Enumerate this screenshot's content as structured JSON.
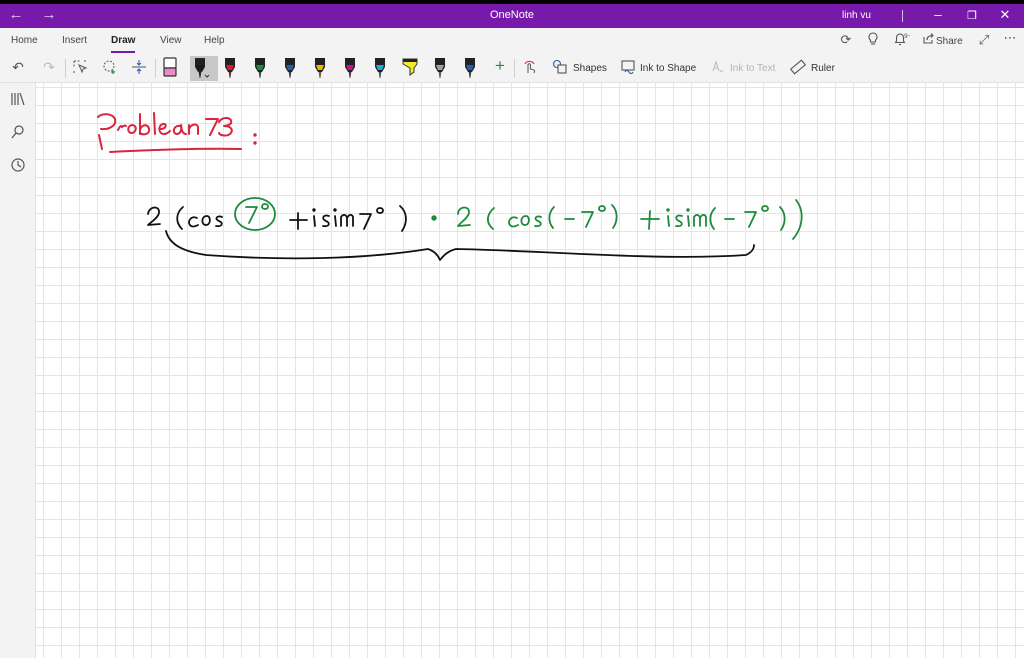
{
  "window": {
    "title": "OneNote",
    "user_name": "linh vu",
    "accent": "#7719aa"
  },
  "ribbon": {
    "tabs": [
      {
        "label": "Home"
      },
      {
        "label": "Insert"
      },
      {
        "label": "Draw",
        "active": true
      },
      {
        "label": "View"
      },
      {
        "label": "Help"
      }
    ],
    "share_label": "Share"
  },
  "toolbar": {
    "pens": [
      {
        "color": "#e98ac8",
        "kind": "eraser"
      },
      {
        "color": "#1a1a1a",
        "kind": "pen",
        "selected": true
      },
      {
        "color": "#d81e2c",
        "kind": "pen"
      },
      {
        "color": "#1a8f3c",
        "kind": "pen"
      },
      {
        "color": "#1f5fae",
        "kind": "pen"
      },
      {
        "color": "#f2b500",
        "kind": "pen"
      },
      {
        "color": "#c4168c",
        "kind": "pen"
      },
      {
        "color": "#1fa9e0",
        "kind": "pen"
      },
      {
        "color": "#f5e82a",
        "kind": "highlighter"
      },
      {
        "color": "#a0a0a0",
        "kind": "pen"
      },
      {
        "color": "#1f5fae",
        "kind": "pen"
      }
    ],
    "shapes_label": "Shapes",
    "ink_to_shape_label": "Ink to Shape",
    "ink_to_text_label": "Ink to Text",
    "ruler_label": "Ruler"
  },
  "note": {
    "ink_colors": {
      "red": "#d7263d",
      "black": "#111111",
      "green": "#1b8a3a"
    }
  }
}
